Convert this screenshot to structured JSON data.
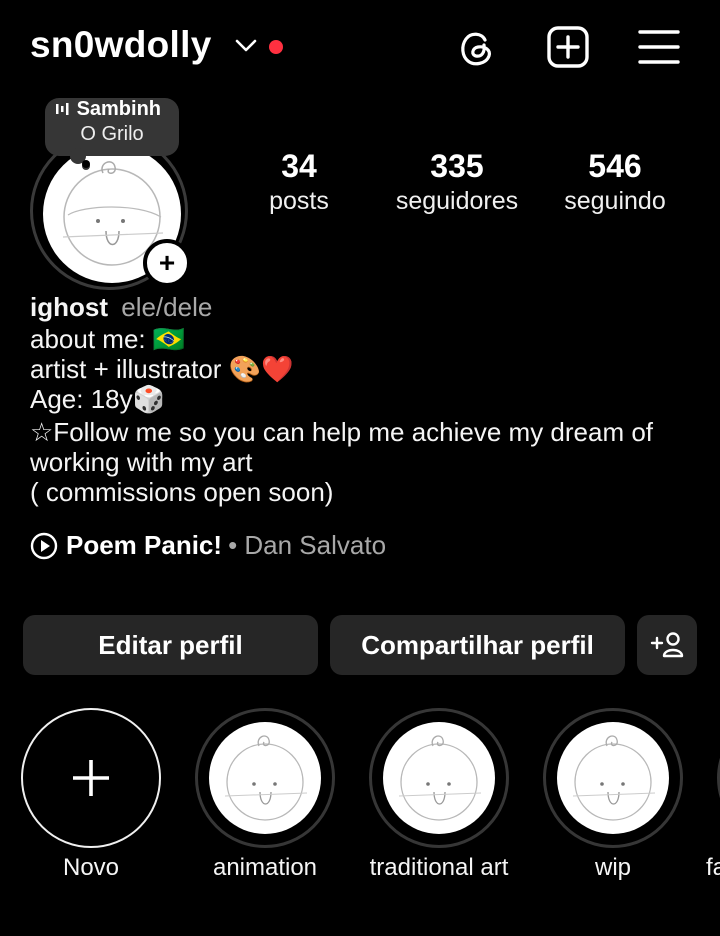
{
  "header": {
    "username": "sn0wdolly",
    "icons": [
      "chevron-down-icon",
      "threads-icon",
      "create-post-icon",
      "menu-icon"
    ],
    "notification_dot_color": "#ff3040"
  },
  "note": {
    "song": "Sambinh",
    "artist": "O Grilo",
    "icon": "audio-bars-icon"
  },
  "stats": [
    {
      "value": "34",
      "label": "posts"
    },
    {
      "value": "335",
      "label": "seguidores"
    },
    {
      "value": "546",
      "label": "seguindo"
    }
  ],
  "bio": {
    "name": "ighost",
    "pronouns": "ele/dele",
    "lines": [
      "about me: 🇧🇷",
      "artist + illustrator 🎨❤️",
      "Age: 18y🎲",
      "☆Follow me so you can help me achieve my dream of",
      "working with my art",
      "( commissions open soon)"
    ]
  },
  "music": {
    "title": "Poem Panic!",
    "artist": "• Dan Salvato"
  },
  "buttons": {
    "edit": "Editar perfil",
    "share": "Compartilhar perfil",
    "add_user_icon": "add-person-icon"
  },
  "highlights": [
    {
      "label": "Novo"
    },
    {
      "label": "animation"
    },
    {
      "label": "traditional art"
    },
    {
      "label": "wip"
    },
    {
      "label": "fa"
    }
  ],
  "colors": {
    "background": "#000000",
    "button_bg": "#262626",
    "secondary_text": "#a8a8a8"
  }
}
